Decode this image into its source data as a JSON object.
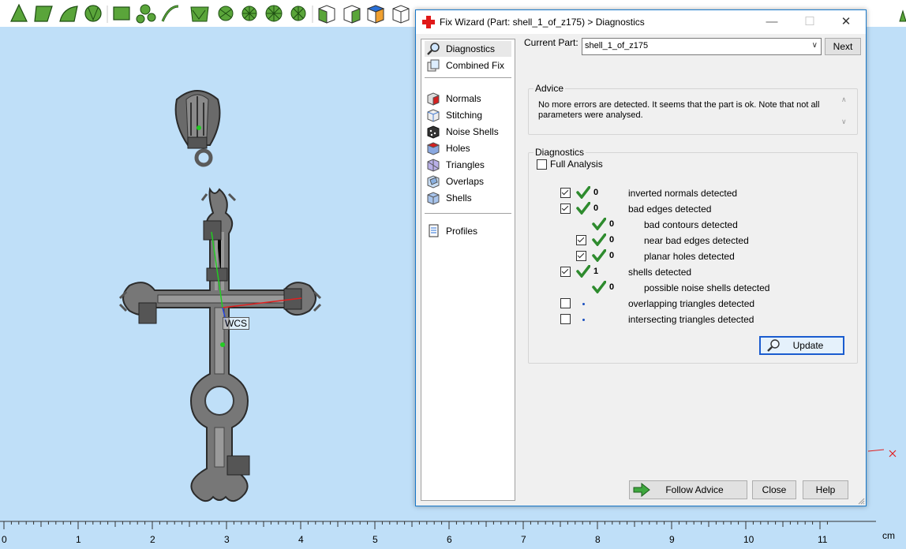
{
  "toolbar": {
    "tools": [
      "mark-triangle-icon",
      "mark-plane-icon",
      "mark-surface-icon",
      "mark-shell-icon",
      "select-box-icon",
      "select-lasso-icon",
      "select-path-icon",
      "select-polyline-icon",
      "select-brush-icon",
      "wireframe-icon",
      "sphere-icon",
      "sphere-mark-icon",
      "cube-front-icon",
      "cube-top-icon",
      "cube-side-icon",
      "cube-iso-icon",
      "view-more-icon"
    ]
  },
  "viewport": {
    "wcs_label": "WCS"
  },
  "ruler": {
    "labels": [
      "0",
      "1",
      "2",
      "3",
      "4",
      "5",
      "6",
      "7",
      "8",
      "9",
      "10",
      "11"
    ],
    "unit": "cm"
  },
  "dialog": {
    "title": "Fix Wizard (Part: shell_1_of_z175) > Diagnostics",
    "window_buttons": {
      "minimize": "—",
      "maximize": "☐",
      "close": "✕"
    },
    "nav": {
      "diagnostics": "Diagnostics",
      "combined_fix": "Combined Fix",
      "normals": "Normals",
      "stitching": "Stitching",
      "noise_shells": "Noise Shells",
      "holes": "Holes",
      "triangles": "Triangles",
      "overlaps": "Overlaps",
      "shells": "Shells",
      "profiles": "Profiles"
    },
    "current_part_label": "Current Part:",
    "current_part_value": "shell_1_of_z175",
    "next_label": "Next",
    "advice": {
      "heading": "Advice",
      "text": "No more errors are detected. It seems that the part is ok. Note that not all parameters were analysed."
    },
    "diagnostics": {
      "heading": "Diagnostics",
      "full_analysis_label": "Full Analysis",
      "rows": [
        {
          "checked": true,
          "status": "ok",
          "count": "0",
          "label": "inverted normals detected"
        },
        {
          "checked": true,
          "status": "ok",
          "count": "0",
          "label": "bad edges detected"
        },
        {
          "checked": null,
          "status": "ok",
          "count": "0",
          "label": "bad contours detected"
        },
        {
          "checked": true,
          "status": "ok",
          "count": "0",
          "label": "near bad edges detected"
        },
        {
          "checked": true,
          "status": "ok",
          "count": "0",
          "label": "planar holes detected"
        },
        {
          "checked": true,
          "status": "ok",
          "count": "1",
          "label": "shells detected"
        },
        {
          "checked": null,
          "status": "ok",
          "count": "0",
          "label": "possible noise shells detected"
        },
        {
          "checked": false,
          "status": "pending",
          "count": "",
          "label": "overlapping triangles detected"
        },
        {
          "checked": false,
          "status": "pending",
          "count": "",
          "label": "intersecting triangles detected"
        }
      ],
      "update_label": "Update"
    },
    "follow_advice_label": "Follow Advice",
    "close_label": "Close",
    "help_label": "Help"
  },
  "colors": {
    "viewport_bg": "#bfdff8",
    "tool_green": "#5aa53a",
    "check_green": "#2e8b2e",
    "title_border": "#1979ca"
  }
}
